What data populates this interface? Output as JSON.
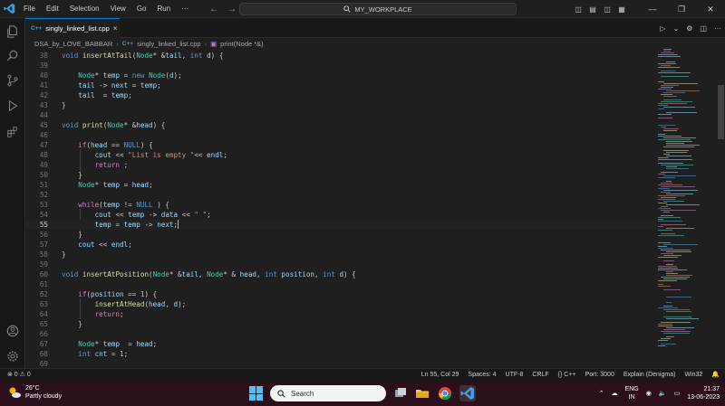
{
  "titlebar": {
    "menu": [
      "File",
      "Edit",
      "Selection",
      "View",
      "Go",
      "Run",
      "···"
    ],
    "search_text": "MY_WORKPLACE"
  },
  "tab": {
    "badge": "C++",
    "label": "singly_linked_list.cpp",
    "close": "×"
  },
  "breadcrumb": {
    "folder": "DSA_by_LOVE_BABBAR",
    "file": "singly_linked_list.cpp",
    "symbol": "print(Node *&)"
  },
  "code": {
    "lines": [
      {
        "n": "38",
        "t": "void insertAtTail(Node* &tail, int d) {"
      },
      {
        "n": "39",
        "t": ""
      },
      {
        "n": "40",
        "t": "    Node* temp = new Node(d);"
      },
      {
        "n": "41",
        "t": "    tail -> next = temp;"
      },
      {
        "n": "42",
        "t": "    tail  = temp;"
      },
      {
        "n": "43",
        "t": "}"
      },
      {
        "n": "44",
        "t": ""
      },
      {
        "n": "45",
        "t": "void print(Node* &head) {"
      },
      {
        "n": "46",
        "t": ""
      },
      {
        "n": "47",
        "t": "    if(head == NULL) {"
      },
      {
        "n": "48",
        "t": "        cout << \"List is empty \"<< endl;"
      },
      {
        "n": "49",
        "t": "        return ;"
      },
      {
        "n": "50",
        "t": "    }"
      },
      {
        "n": "51",
        "t": "    Node* temp = head;"
      },
      {
        "n": "52",
        "t": ""
      },
      {
        "n": "53",
        "t": "    while(temp != NULL ) {"
      },
      {
        "n": "54",
        "t": "        cout << temp -> data << \" \";"
      },
      {
        "n": "55",
        "t": "        temp = temp -> next;"
      },
      {
        "n": "56",
        "t": "    }"
      },
      {
        "n": "57",
        "t": "    cout << endl;"
      },
      {
        "n": "58",
        "t": "}"
      },
      {
        "n": "59",
        "t": ""
      },
      {
        "n": "60",
        "t": "void insertAtPosition(Node* &tail, Node* & head, int position, int d) {"
      },
      {
        "n": "61",
        "t": ""
      },
      {
        "n": "62",
        "t": "    if(position == 1) {"
      },
      {
        "n": "63",
        "t": "        insertAtHead(head, d);"
      },
      {
        "n": "64",
        "t": "        return;"
      },
      {
        "n": "65",
        "t": "    }"
      },
      {
        "n": "66",
        "t": ""
      },
      {
        "n": "67",
        "t": "    Node* temp  = head;"
      },
      {
        "n": "68",
        "t": "    int cnt = 1;"
      },
      {
        "n": "69",
        "t": ""
      }
    ]
  },
  "statusbar": {
    "problems": "⊗ 0 ⚠ 0",
    "items": [
      "Ln 55, Col 29",
      "Spaces: 4",
      "UTF-8",
      "CRLF",
      "{} C++",
      "Port: 3000",
      "Explain (Denigma)",
      "Win32"
    ]
  },
  "taskbar": {
    "temp": "26°C",
    "weather": "Partly cloudy",
    "search": "Search",
    "lang_top": "ENG",
    "lang_bottom": "IN",
    "time": "21:37",
    "date": "13-06-2023"
  },
  "colors": {
    "accent": "#0078d4",
    "keyword": "#569cd6",
    "type": "#4ec9b0",
    "function": "#dcdcaa",
    "variable": "#9cdcfe",
    "string": "#ce9178",
    "control": "#c586c0"
  }
}
